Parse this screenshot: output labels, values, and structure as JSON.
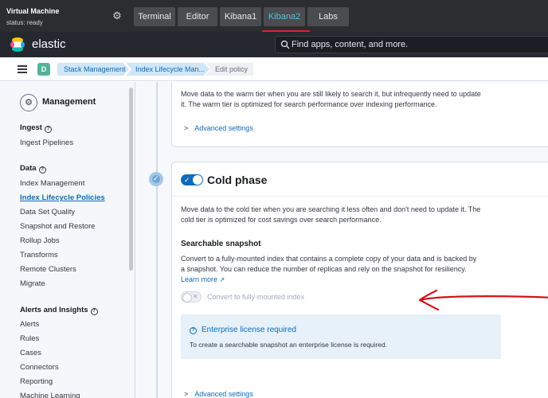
{
  "vm": {
    "title": "Virtual Machine",
    "status": "status: ready",
    "tabs": [
      {
        "label": "Terminal"
      },
      {
        "label": "Editor"
      },
      {
        "label": "Kibana1"
      },
      {
        "label": "Kibana2"
      },
      {
        "label": "Labs"
      }
    ],
    "active_tab": "Kibana2"
  },
  "header": {
    "brand": "elastic",
    "search_placeholder": "Find apps, content, and more."
  },
  "breadcrumb": {
    "space_initial": "D",
    "items": [
      "Stack Management",
      "Index Lifecycle Man...",
      "Edit policy"
    ]
  },
  "sidebar": {
    "title": "Management",
    "sections": [
      {
        "heading": "Ingest",
        "items": [
          "Ingest Pipelines"
        ]
      },
      {
        "heading": "Data",
        "items": [
          "Index Management",
          "Index Lifecycle Policies",
          "Data Set Quality",
          "Snapshot and Restore",
          "Rollup Jobs",
          "Transforms",
          "Remote Clusters",
          "Migrate"
        ]
      },
      {
        "heading": "Alerts and Insights",
        "items": [
          "Alerts",
          "Rules",
          "Cases",
          "Connectors",
          "Reporting",
          "Machine Learning"
        ]
      }
    ],
    "active_item": "Index Lifecycle Policies"
  },
  "warm": {
    "desc_line1": "Move data to the warm tier when you are still likely to search it, but infrequently need to update",
    "desc_line2": "it. The warm tier is optimized for search performance over indexing performance.",
    "advanced": "Advanced settings"
  },
  "cold": {
    "title": "Cold phase",
    "desc_line1": "Move data to the cold tier when you are searching it less often and don't need to update it. The",
    "desc_line2": "cold tier is optimized for cost savings over search performance.",
    "ss_title": "Searchable snapshot",
    "ss_line1": "Convert to a fully-mounted index that contains a complete copy of your data and is backed by",
    "ss_line2": "a snapshot. You can reduce the number of replicas and rely on the snapshot for resiliency.",
    "learn_more": "Learn more",
    "convert_label": "Convert to fully-mounted index",
    "callout_title": "Enterprise license required",
    "callout_body": "To create a searchable snapshot an enterprise license is required.",
    "advanced": "Advanced settings"
  },
  "colors": {
    "accent": "#0e6bb5",
    "annotation_arrow": "#d4141c",
    "vm_bar": "#2b2d2f",
    "elastic_bar": "#25282f"
  }
}
